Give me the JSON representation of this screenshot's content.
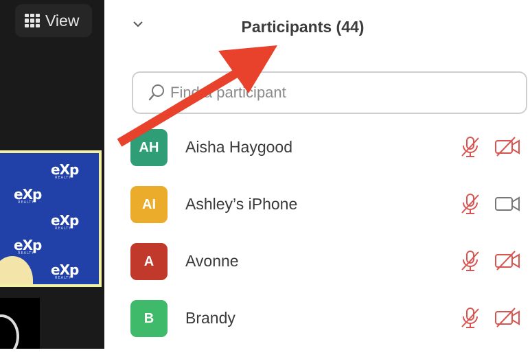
{
  "toolbar": {
    "view_label": "View",
    "view_icon": "grid-icon"
  },
  "video_tile": {
    "logo_text": "eXp",
    "logo_sub": "REALTY"
  },
  "panel": {
    "title": "Participants (44)",
    "collapse_icon": "chevron-down-icon"
  },
  "search": {
    "placeholder": "Find a participant",
    "icon": "search-icon"
  },
  "participants": [
    {
      "initials": "AH",
      "name": "Aisha Haygood",
      "avatar_color": "#2f9e77",
      "mic": "muted",
      "camera": "off"
    },
    {
      "initials": "AI",
      "name": "Ashley’s iPhone",
      "avatar_color": "#ebab2b",
      "mic": "muted",
      "camera": "on"
    },
    {
      "initials": "A",
      "name": "Avonne",
      "avatar_color": "#c0392b",
      "mic": "muted",
      "camera": "off"
    },
    {
      "initials": "B",
      "name": "Brandy",
      "avatar_color": "#3fb96a",
      "mic": "muted",
      "camera": "off"
    }
  ],
  "colors": {
    "muted_icon": "#d9534f",
    "neutral_icon": "#777777",
    "annotation_arrow": "#e8412c",
    "dark_background": "#1a1a1a"
  }
}
